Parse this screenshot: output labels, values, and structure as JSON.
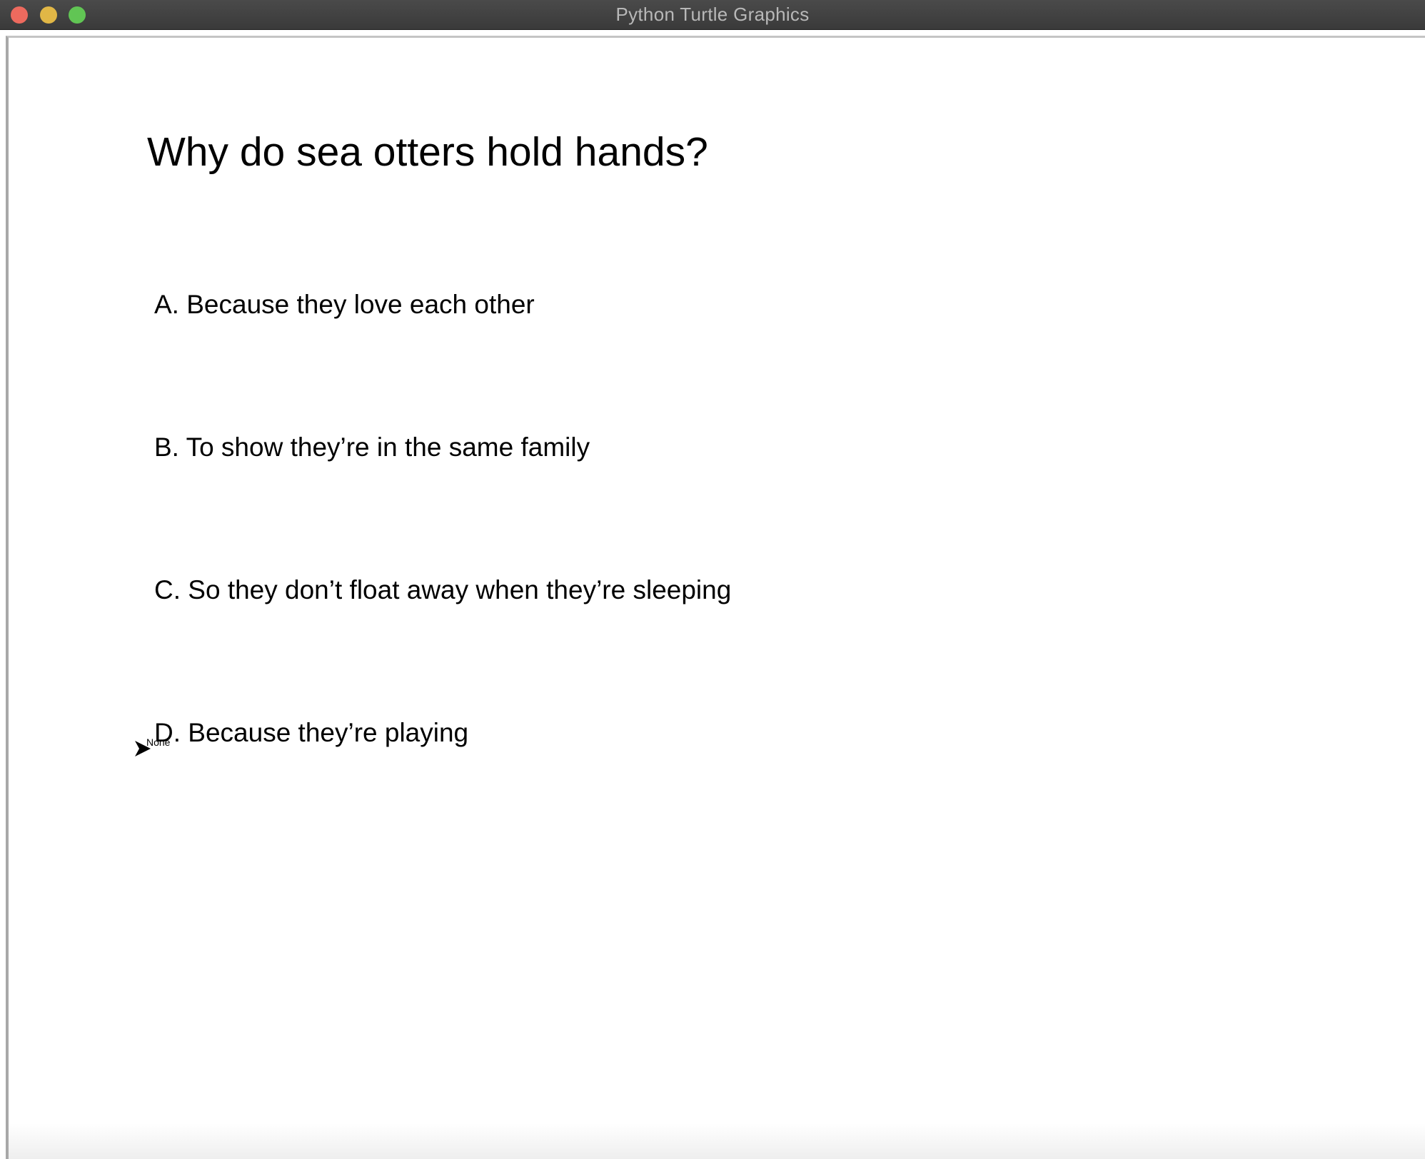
{
  "window": {
    "title": "Python Turtle Graphics"
  },
  "canvas": {
    "question": "Why do sea otters hold hands?",
    "options": [
      {
        "label": "A. Because they love each other"
      },
      {
        "label": "B. To show they’re in the same family"
      },
      {
        "label": "C. So they don’t float away when they’re sleeping"
      },
      {
        "label": "D. Because they’re playing"
      }
    ],
    "turtle": {
      "label": "None",
      "icon": "turtle-arrow-icon"
    }
  },
  "colors": {
    "close": "#ed6a5e",
    "minimize": "#e1b746",
    "maximize": "#61c554",
    "titlebar": "#3f3f3f",
    "canvas": "#ffffff",
    "text": "#000000"
  }
}
